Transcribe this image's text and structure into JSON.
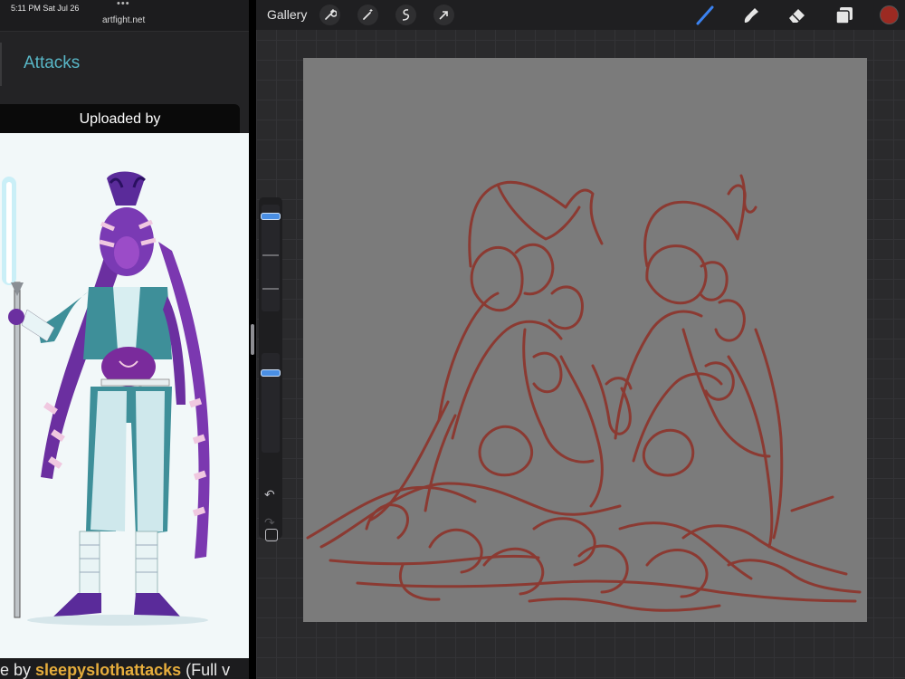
{
  "status_bar": {
    "time": "5:11 PM  Sat Jul 26",
    "dots": "•••",
    "url": "artfight.net"
  },
  "site": {
    "attacks_tab": "Attacks",
    "tooltip_line1": "Uploaded by",
    "tooltip_line2": "sleepyslothattacks",
    "credit_prefix": "e by ",
    "credit_user": "sleepyslothattacks",
    "credit_suffix": " (Full v"
  },
  "procreate": {
    "gallery_label": "Gallery",
    "tools": [
      "wrench-icon",
      "magic-wand-icon",
      "selection-icon",
      "transform-arrow-icon"
    ],
    "right_tools": [
      "brush-icon",
      "smudge-icon",
      "eraser-icon",
      "layers-icon"
    ],
    "active_tool": "brush-icon",
    "current_color": "#9c2a22",
    "canvas_color": "#7b7b7b",
    "sketch_color": "#8b3a32",
    "brush_size_level": 0.15,
    "opacity_level": 0.25,
    "undo_icon": "↶",
    "redo_icon": "↷"
  }
}
